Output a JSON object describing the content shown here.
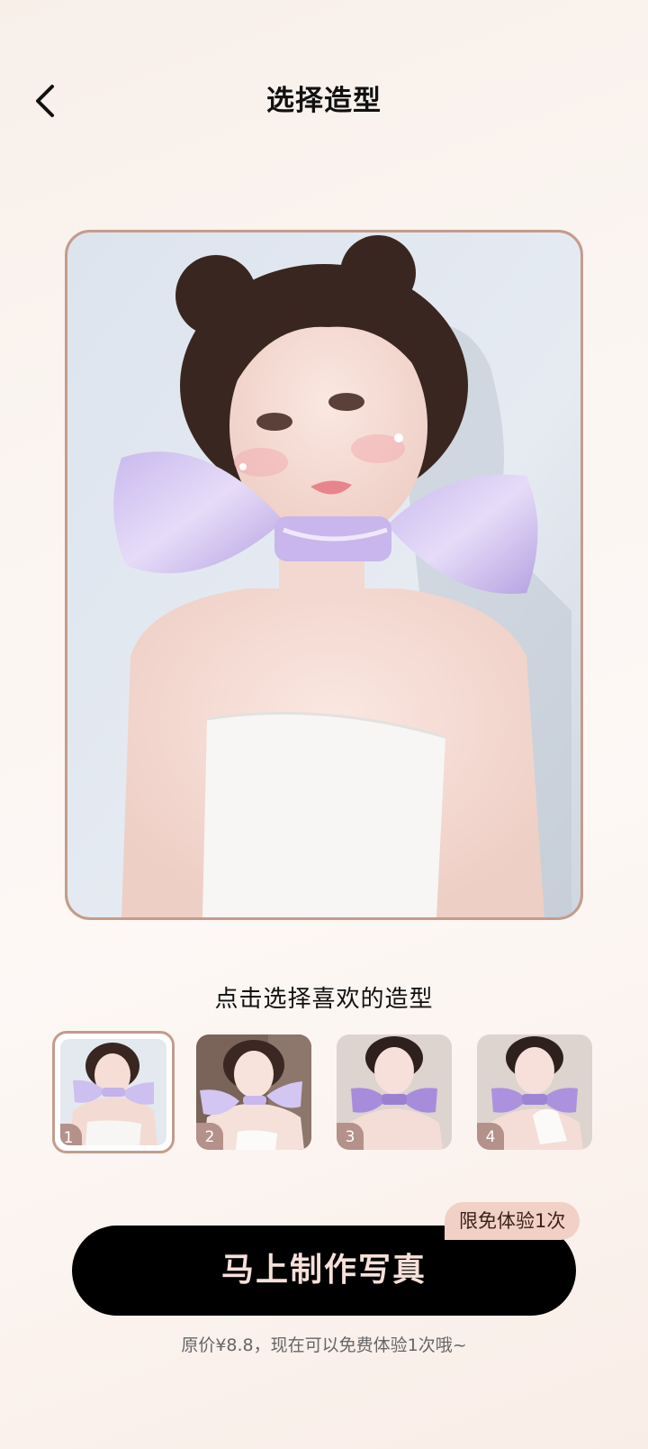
{
  "header": {
    "title": "选择造型",
    "back_icon": "chevron-left-icon"
  },
  "preview": {
    "selected_index": 1
  },
  "selector": {
    "hint": "点击选择喜欢的造型",
    "items": [
      {
        "number": "1"
      },
      {
        "number": "2"
      },
      {
        "number": "3"
      },
      {
        "number": "4"
      }
    ]
  },
  "cta": {
    "button_label": "马上制作写真",
    "promo_badge": "限免体验1次",
    "price_note": "原价¥8.8，现在可以免费体验1次哦~"
  },
  "colors": {
    "accent_border": "#c49c8c",
    "badge_bg": "#b4918a",
    "cta_bg": "#000000",
    "cta_text": "#f6e0d8",
    "promo_bg": "#f1d0c5"
  }
}
